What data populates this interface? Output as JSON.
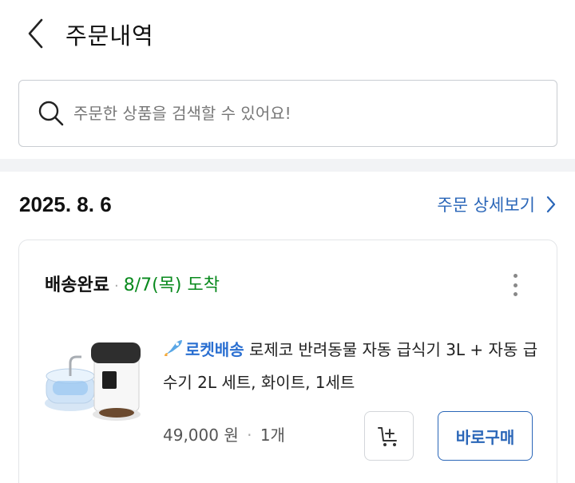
{
  "header": {
    "title": "주문내역"
  },
  "search": {
    "placeholder": "주문한 상품을 검색할 수 있어요!"
  },
  "order": {
    "date": "2025. 8. 6",
    "detail_link": "주문 상세보기",
    "status": "배송완료",
    "status_sep": "·",
    "arrival": "8/7(목) 도착",
    "delivery_badge": "로켓배송",
    "product_name": "로제코 반려동물 자동 급식기 3L + 자동 급수기 2L 세트, 화이트, 1세트",
    "price": "49,000 원",
    "price_sep": "·",
    "quantity": "1개",
    "buy_button": "바로구매"
  },
  "colors": {
    "accent": "#2a66b8",
    "arrival_green": "#0a8a1e",
    "rocket_blue": "#2a6fd1"
  },
  "icons": [
    "back-chevron-icon",
    "search-icon",
    "chevron-right-icon",
    "more-vertical-icon",
    "rocket-icon",
    "add-to-cart-icon"
  ]
}
